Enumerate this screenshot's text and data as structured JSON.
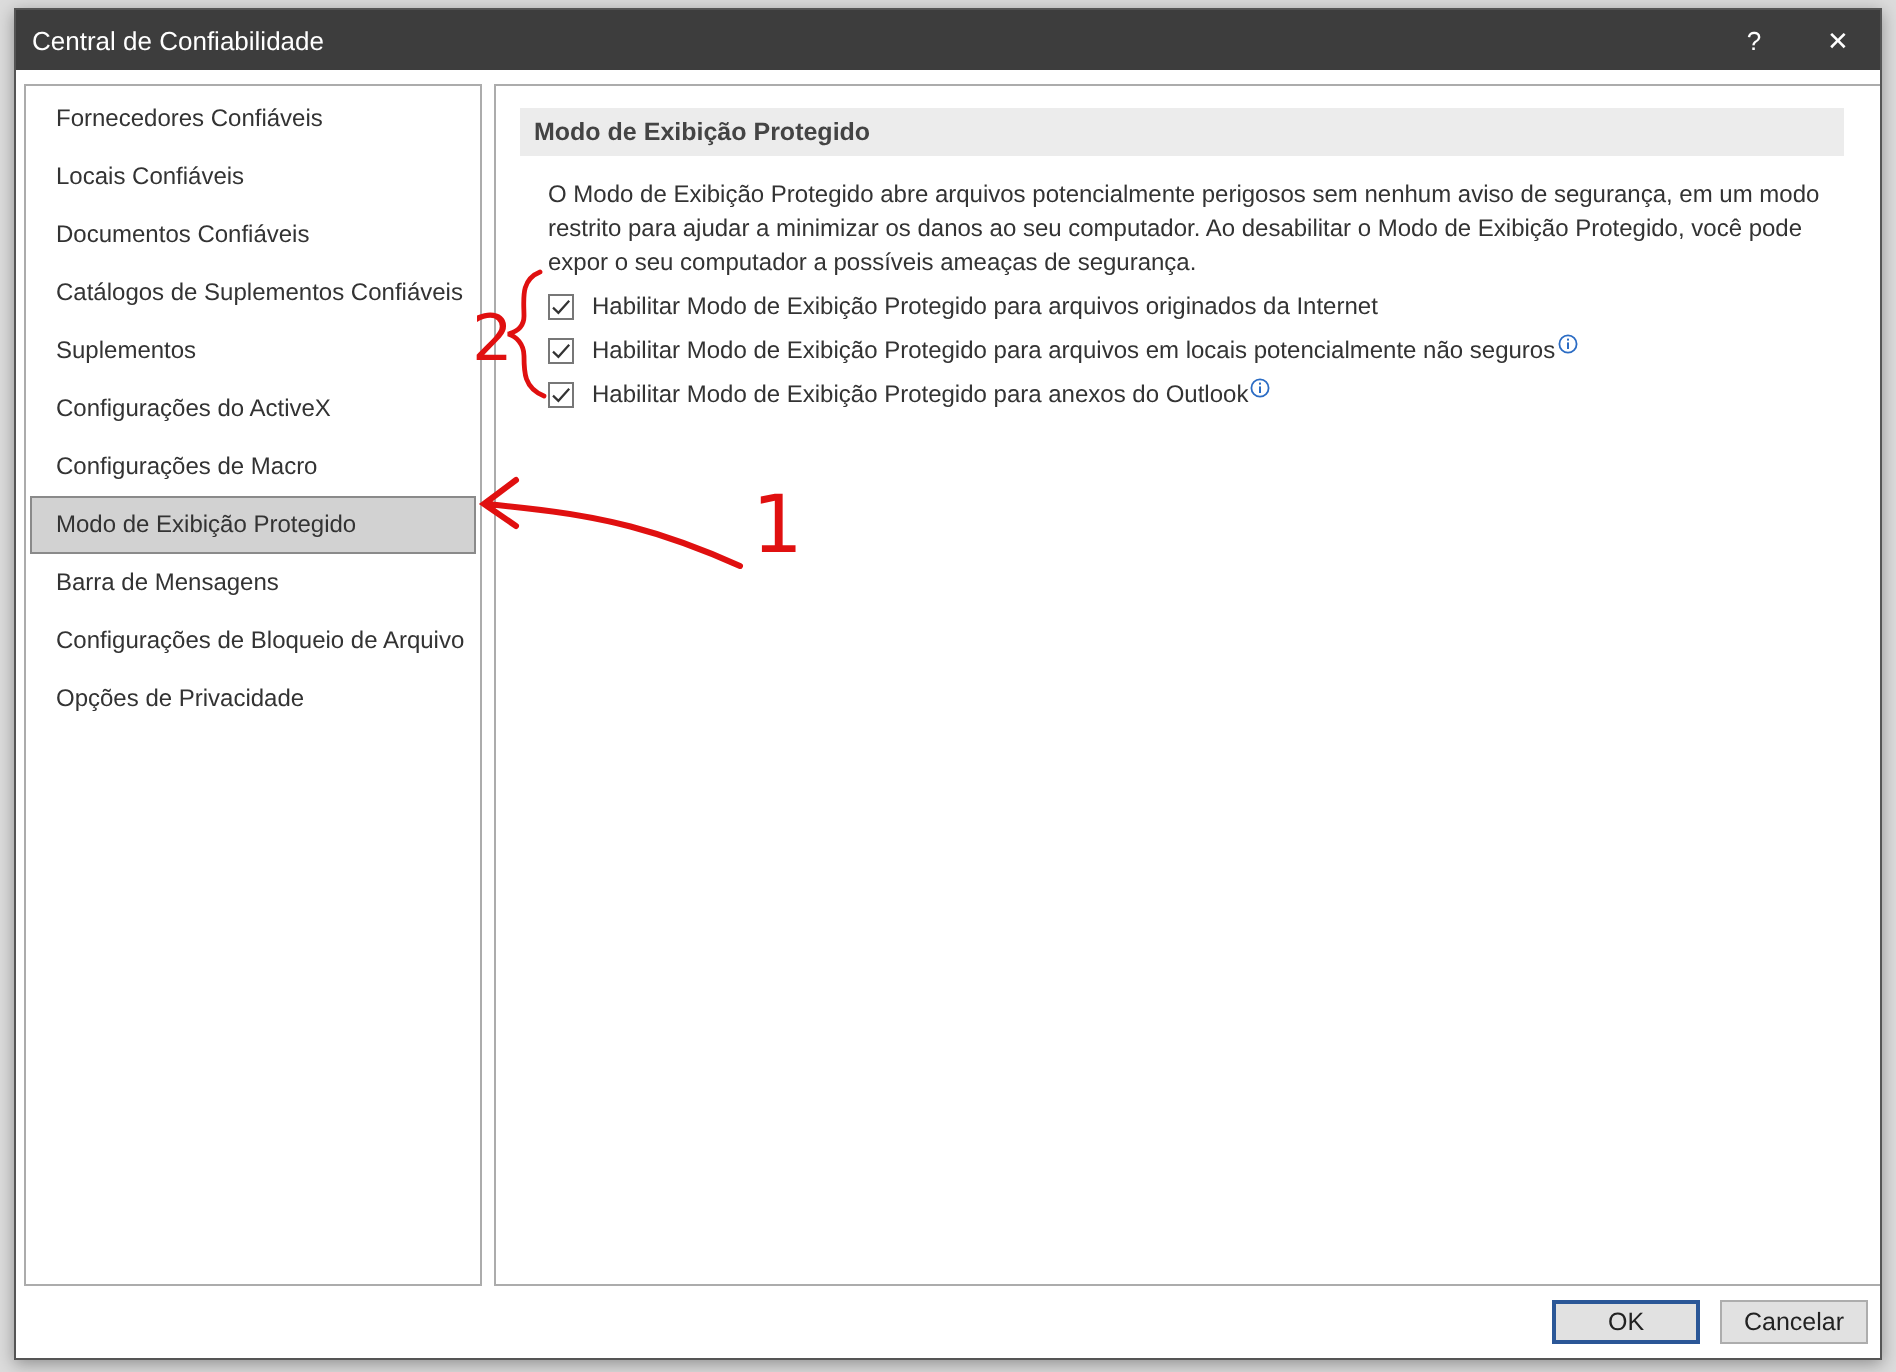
{
  "window": {
    "title": "Central de Confiabilidade",
    "help_button": "?",
    "close_button": "✕"
  },
  "sidebar": {
    "items": [
      {
        "label": "Fornecedores Confiáveis",
        "selected": false
      },
      {
        "label": "Locais Confiáveis",
        "selected": false
      },
      {
        "label": "Documentos Confiáveis",
        "selected": false
      },
      {
        "label": "Catálogos de Suplementos Confiáveis",
        "selected": false
      },
      {
        "label": "Suplementos",
        "selected": false
      },
      {
        "label": "Configurações do ActiveX",
        "selected": false
      },
      {
        "label": "Configurações de Macro",
        "selected": false
      },
      {
        "label": "Modo de Exibição Protegido",
        "selected": true
      },
      {
        "label": "Barra de Mensagens",
        "selected": false
      },
      {
        "label": "Configurações de Bloqueio de Arquivo",
        "selected": false
      },
      {
        "label": "Opções de Privacidade",
        "selected": false
      }
    ]
  },
  "section": {
    "heading": "Modo de Exibição Protegido",
    "description": "O Modo de Exibição Protegido abre arquivos potencialmente perigosos sem nenhum aviso de segurança, em um modo restrito para ajudar a minimizar os danos ao seu computador. Ao desabilitar o Modo de Exibição Protegido, você pode expor o seu computador a possíveis ameaças de segurança.",
    "options": [
      {
        "label": "Habilitar Modo de Exibição Protegido para arquivos originados da Internet",
        "checked": true,
        "info": false
      },
      {
        "label": "Habilitar Modo de Exibição Protegido para arquivos em locais potencialmente não seguros",
        "checked": true,
        "info": true
      },
      {
        "label": "Habilitar Modo de Exibição Protegido para anexos do Outlook",
        "checked": true,
        "info": true
      }
    ]
  },
  "buttons": [
    {
      "label": "OK",
      "kind": "default"
    },
    {
      "label": "Cancelar",
      "kind": "normal"
    }
  ],
  "annotations": [
    {
      "label": "1",
      "kind": "arrow"
    },
    {
      "label": "2",
      "kind": "brace"
    }
  ]
}
